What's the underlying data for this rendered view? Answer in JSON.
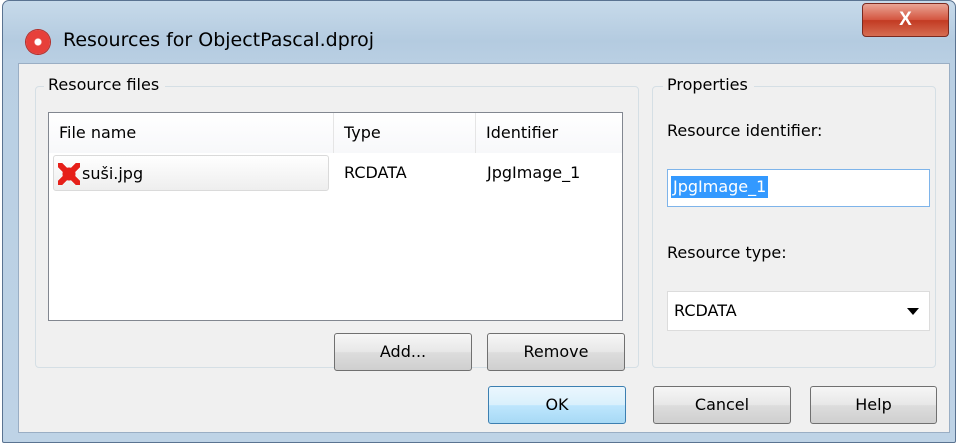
{
  "window": {
    "title": "Resources for ObjectPascal.dproj",
    "close_label": "X"
  },
  "resource_files": {
    "group_label": "Resource files",
    "columns": [
      "File name",
      "Type",
      "Identifier"
    ],
    "rows": [
      {
        "file_name": "suši.jpg",
        "type": "RCDATA",
        "identifier": "JpgImage_1",
        "icon": "red-splat-file-icon"
      }
    ],
    "add_label": "Add...",
    "remove_label": "Remove"
  },
  "properties": {
    "group_label": "Properties",
    "id_label": "Resource identifier:",
    "id_value": "JpgImage_1",
    "type_label": "Resource type:",
    "type_value": "RCDATA"
  },
  "footer": {
    "ok_label": "OK",
    "cancel_label": "Cancel",
    "help_label": "Help"
  }
}
